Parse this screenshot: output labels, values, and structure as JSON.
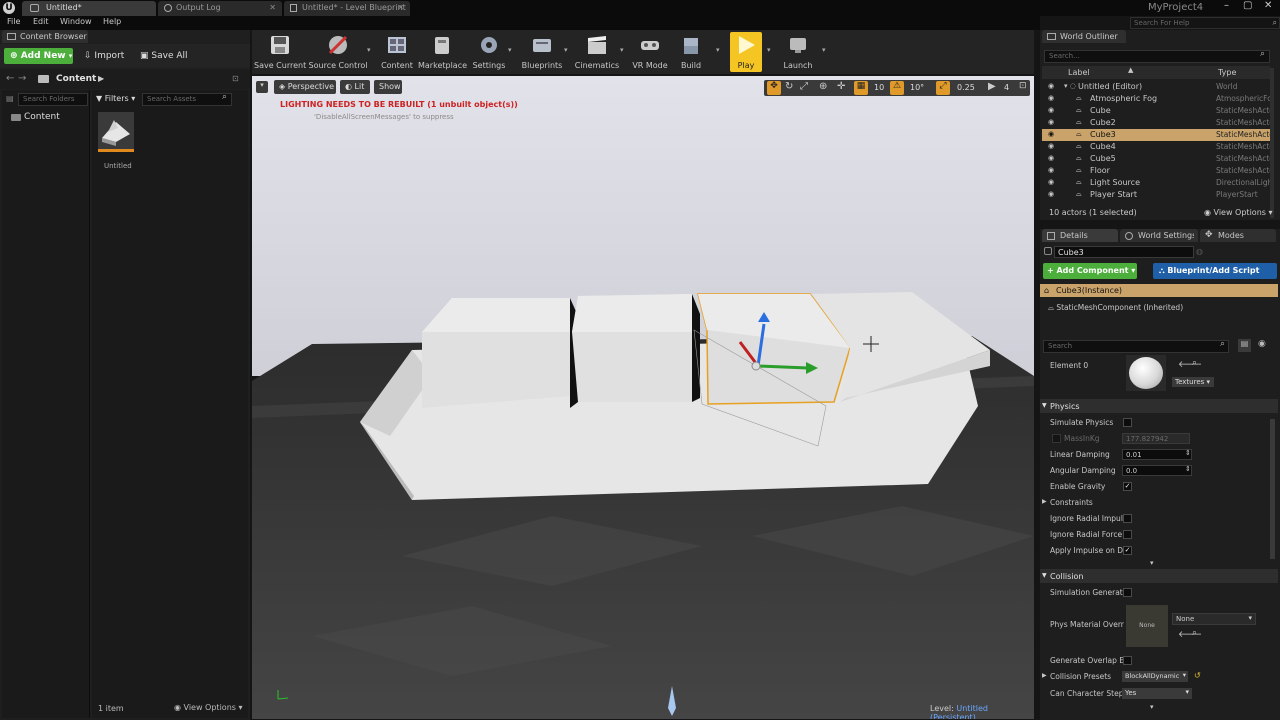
{
  "window_tabs": [
    {
      "label": "Untitled*"
    },
    {
      "label": "Output Log"
    },
    {
      "label": "Untitled* - Level Blueprint"
    }
  ],
  "project_name": "MyProject4",
  "help_search_placeholder": "Search For Help",
  "menu": {
    "file": "File",
    "edit": "Edit",
    "window": "Window",
    "help": "Help"
  },
  "content_browser": {
    "tab_title": "Content Browser",
    "add_new": "Add New",
    "import": "Import",
    "save_all": "Save All",
    "path": "Content",
    "folder_search_placeholder": "Search Folders",
    "filters": "Filters",
    "asset_search_placeholder": "Search Assets",
    "root_folder": "Content",
    "asset_name": "Untitled",
    "item_count": "1 item",
    "view_options": "View Options"
  },
  "toolbar": [
    {
      "label": "Save Current"
    },
    {
      "label": "Source Control"
    },
    {
      "label": "Content"
    },
    {
      "label": "Marketplace"
    },
    {
      "label": "Settings"
    },
    {
      "label": "Blueprints"
    },
    {
      "label": "Cinematics"
    },
    {
      "label": "VR Mode"
    },
    {
      "label": "Build"
    },
    {
      "label": "Play"
    },
    {
      "label": "Launch"
    }
  ],
  "viewport": {
    "perspective": "Perspective",
    "lit": "Lit",
    "show": "Show",
    "warning": "LIGHTING NEEDS TO BE REBUILT (1 unbuilt object(s))",
    "suppress_hint": "'DisableAllScreenMessages' to suppress",
    "grid_snap": "10",
    "rotation_snap": "10°",
    "scale_snap": "0.25",
    "camera_speed": "4",
    "level_label": "Level:",
    "level_name": "Untitled (Persistent)"
  },
  "world_outliner": {
    "tab_title": "World Outliner",
    "search_placeholder": "Search...",
    "col_label": "Label",
    "col_type": "Type",
    "rows": [
      {
        "label": "Untitled (Editor)",
        "type": "World"
      },
      {
        "label": "Atmospheric Fog",
        "type": "AtmosphericFog"
      },
      {
        "label": "Cube",
        "type": "StaticMeshActor"
      },
      {
        "label": "Cube2",
        "type": "StaticMeshActor"
      },
      {
        "label": "Cube3",
        "type": "StaticMeshActor"
      },
      {
        "label": "Cube4",
        "type": "StaticMeshActor"
      },
      {
        "label": "Cube5",
        "type": "StaticMeshActor"
      },
      {
        "label": "Floor",
        "type": "StaticMeshActor"
      },
      {
        "label": "Light Source",
        "type": "DirectionalLight"
      },
      {
        "label": "Player Start",
        "type": "PlayerStart"
      }
    ],
    "selected_index": 4,
    "actor_count": "10 actors (1 selected)",
    "view_options": "View Options"
  },
  "details": {
    "tab_details": "Details",
    "tab_world": "World Settings",
    "tab_modes": "Modes",
    "name": "Cube3",
    "add_component": "+ Add Component",
    "blueprint_script": "Blueprint/Add Script",
    "instance": "Cube3(Instance)",
    "component": "StaticMeshComponent (Inherited)",
    "search_placeholder": "Search",
    "element0": "Element 0",
    "textures": "Textures",
    "physics_header": "Physics",
    "simulate_physics": "Simulate Physics",
    "mass_label": "MassInKg",
    "mass_value": "177.827942",
    "linear_damping": "Linear Damping",
    "linear_damping_value": "0.01",
    "angular_damping": "Angular Damping",
    "angular_damping_value": "0.0",
    "enable_gravity": "Enable Gravity",
    "constraints": "Constraints",
    "ignore_radial_impulse": "Ignore Radial Impuls",
    "ignore_radial_force": "Ignore Radial Force",
    "apply_impulse": "Apply Impulse on Da",
    "collision_header": "Collision",
    "simulation_generate": "Simulation Generate",
    "phys_material": "Phys Material Overr",
    "phys_material_value": "None",
    "phys_material_thumb": "None",
    "generate_overlap": "Generate Overlap Ev",
    "collision_presets": "Collision Presets",
    "collision_presets_value": "BlockAllDynamic",
    "can_character_step": "Can Character Step",
    "can_character_step_value": "Yes"
  },
  "colors": {
    "accent_green": "#4caf3c",
    "accent_blue": "#1e5fa8",
    "selection": "#caa36a",
    "warning_red": "#cc2222",
    "play_yellow": "#f5c623"
  }
}
